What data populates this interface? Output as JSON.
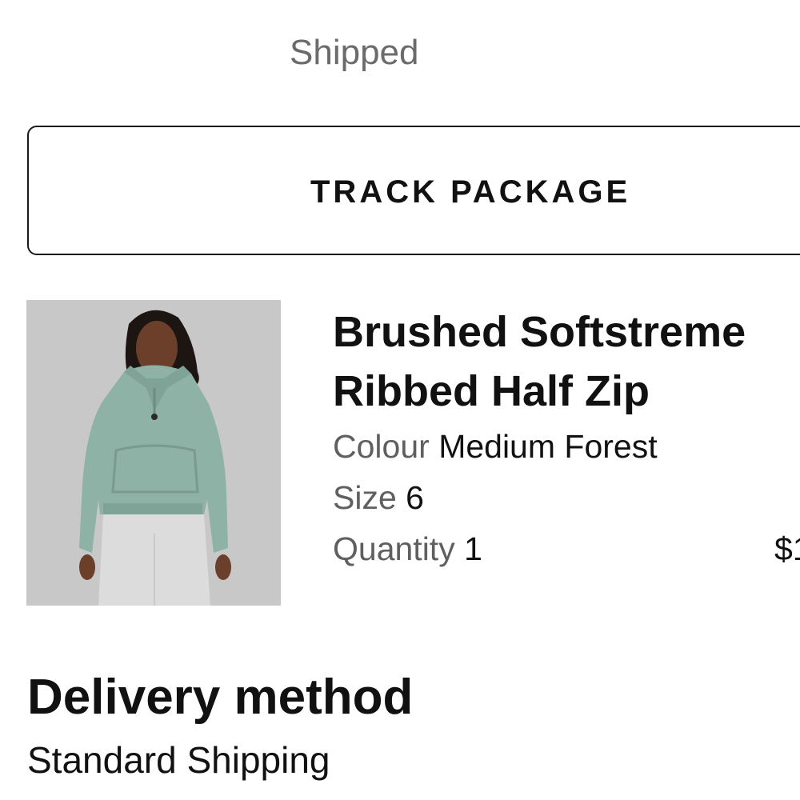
{
  "order": {
    "status": "Shipped",
    "track_label": "TRACK PACKAGE"
  },
  "product": {
    "name": "Brushed Softstreme Ribbed Half Zip",
    "colour_label": "Colour",
    "colour_value": "Medium Forest",
    "size_label": "Size",
    "size_value": "6",
    "quantity_label": "Quantity",
    "quantity_value": "1",
    "price_visible": "$1",
    "image_colors": {
      "background": "#c8c8c8",
      "top": "#8fb2a7",
      "pants": "#dcdcdc",
      "skin": "#6b3f2a"
    }
  },
  "delivery": {
    "heading": "Delivery method",
    "value": "Standard Shipping"
  }
}
